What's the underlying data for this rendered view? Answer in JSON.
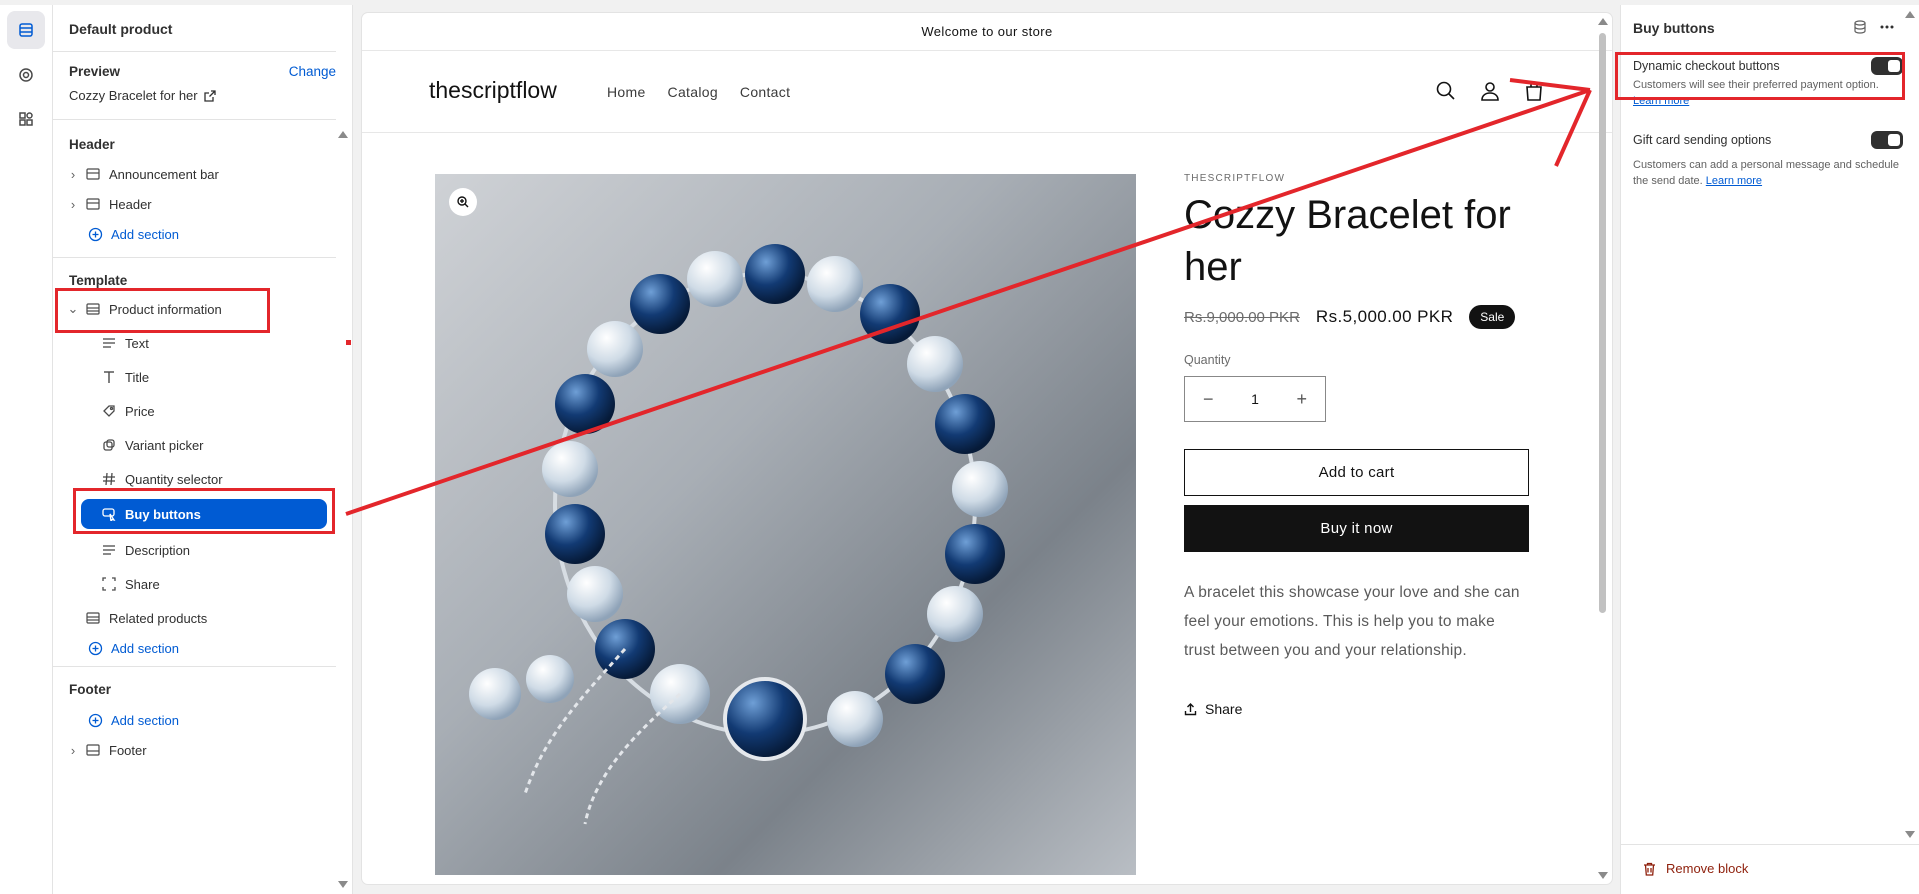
{
  "sidebar": {
    "title": "Default product",
    "preview_label": "Preview",
    "change_label": "Change",
    "preview_product": "Cozzy Bracelet for her",
    "header_section": "Header",
    "header_items": [
      "Announcement bar",
      "Header"
    ],
    "add_section": "Add section",
    "template_section": "Template",
    "product_information": "Product information",
    "blocks": [
      "Text",
      "Title",
      "Price",
      "Variant picker",
      "Quantity selector",
      "Buy buttons",
      "Description",
      "Share"
    ],
    "related_products": "Related products",
    "footer_section": "Footer",
    "footer_item": "Footer"
  },
  "store": {
    "announcement": "Welcome to our store",
    "logo": "thescriptflow",
    "nav": [
      "Home",
      "Catalog",
      "Contact"
    ],
    "vendor": "THESCRIPTFLOW",
    "product_title": "Cozzy Bracelet for her",
    "old_price": "Rs.9,000.00 PKR",
    "new_price": "Rs.5,000.00 PKR",
    "sale_badge": "Sale",
    "quantity_label": "Quantity",
    "quantity_value": "1",
    "add_to_cart": "Add to cart",
    "buy_now": "Buy it now",
    "description": "A bracelet this showcase your love and she can feel your emotions. This is help you to make trust between you and your relationship.",
    "share": "Share"
  },
  "settings": {
    "title": "Buy buttons",
    "dynamic_checkout_label": "Dynamic checkout buttons",
    "dynamic_checkout_help": "Customers will see their preferred payment option.",
    "dynamic_checkout_enabled": true,
    "learn_more": "Learn more",
    "gift_card_label": "Gift card sending options",
    "gift_card_help": "Customers can add a personal message and schedule the send date.",
    "gift_card_enabled": true,
    "remove_block": "Remove block"
  },
  "colors": {
    "accent": "#005bd3",
    "annotation": "#e3262b",
    "remove": "#8e1f0b"
  }
}
